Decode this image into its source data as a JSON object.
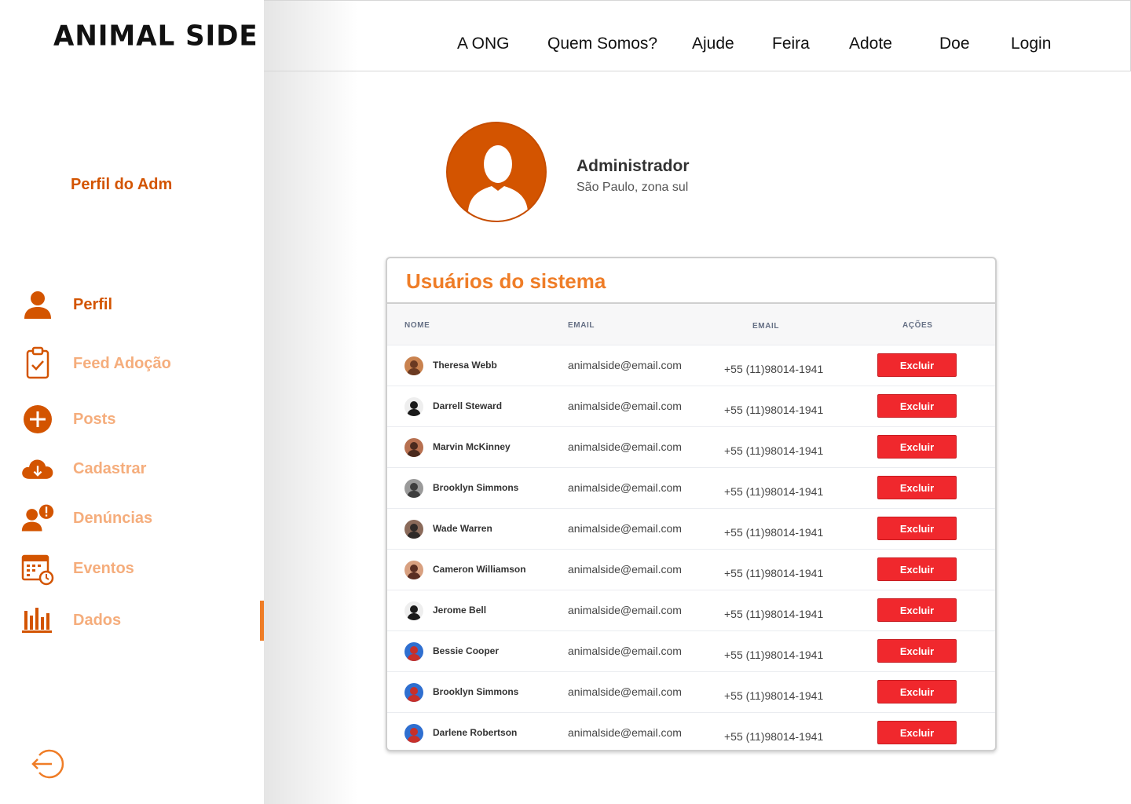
{
  "brand": {
    "logo_text": "ANIMAL SIDE"
  },
  "colors": {
    "accent": "#d35400",
    "accent_light": "#f5ad7c",
    "orange": "#ef7d27",
    "danger": "#f0282d"
  },
  "topnav": {
    "links": [
      "A ONG",
      "Quem Somos?",
      "Ajude",
      "Feira",
      "Adote",
      "Doe",
      "Login"
    ]
  },
  "sidebar": {
    "title": "Perfil do Adm",
    "items": [
      {
        "label": "Perfil",
        "icon": "user-icon"
      },
      {
        "label": "Feed Adoção",
        "icon": "clipboard-check-icon"
      },
      {
        "label": "Posts",
        "icon": "plus-circle-icon"
      },
      {
        "label": "Cadastrar",
        "icon": "cloud-download-icon"
      },
      {
        "label": "Denúncias",
        "icon": "user-alert-icon"
      },
      {
        "label": "Eventos",
        "icon": "calendar-clock-icon"
      },
      {
        "label": "Dados",
        "icon": "bar-chart-icon"
      }
    ],
    "logout_icon": "logout-icon"
  },
  "profile": {
    "name": "Administrador",
    "location": "São Paulo, zona sul"
  },
  "users_table": {
    "title": "Usuários do sistema",
    "headers": [
      "NOME",
      "EMAIL",
      "EMAIL",
      "AÇÕES"
    ],
    "action_label": "Excluir",
    "rows": [
      {
        "name": "Theresa Webb",
        "email": "animalside@email.com",
        "phone": "+55 (11)98014-1941"
      },
      {
        "name": "Darrell Steward",
        "email": "animalside@email.com",
        "phone": "+55 (11)98014-1941"
      },
      {
        "name": "Marvin McKinney",
        "email": "animalside@email.com",
        "phone": "+55 (11)98014-1941"
      },
      {
        "name": "Brooklyn Simmons",
        "email": "animalside@email.com",
        "phone": "+55 (11)98014-1941"
      },
      {
        "name": "Wade Warren",
        "email": "animalside@email.com",
        "phone": "+55 (11)98014-1941"
      },
      {
        "name": "Cameron Williamson",
        "email": "animalside@email.com",
        "phone": "+55 (11)98014-1941"
      },
      {
        "name": "Jerome Bell",
        "email": "animalside@email.com",
        "phone": "+55 (11)98014-1941"
      },
      {
        "name": "Bessie Cooper",
        "email": "animalside@email.com",
        "phone": "+55 (11)98014-1941"
      },
      {
        "name": "Brooklyn Simmons",
        "email": "animalside@email.com",
        "phone": "+55 (11)98014-1941"
      },
      {
        "name": "Darlene Robertson",
        "email": "animalside@email.com",
        "phone": "+55 (11)98014-1941"
      }
    ]
  }
}
